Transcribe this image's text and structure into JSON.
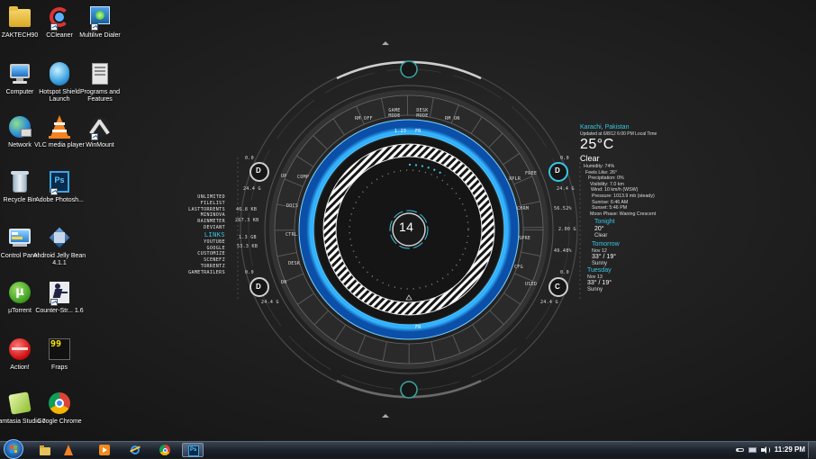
{
  "desktop_icons": [
    {
      "label": "ZAKTECH90",
      "icon": "folder-icon"
    },
    {
      "label": "CCleaner",
      "icon": "ccleaner-icon"
    },
    {
      "label": "Multilive Dialer",
      "icon": "dialer-icon"
    },
    {
      "label": "Computer",
      "icon": "computer-icon"
    },
    {
      "label": "Hotspot Shield Launch",
      "icon": "hotspot-shield-icon"
    },
    {
      "label": "Programs and Features",
      "icon": "programs-features-icon"
    },
    {
      "label": "Network",
      "icon": "network-icon"
    },
    {
      "label": "VLC media player",
      "icon": "vlc-icon"
    },
    {
      "label": "WinMount",
      "icon": "winmount-icon"
    },
    {
      "label": "Recycle Bin",
      "icon": "recycle-bin-icon"
    },
    {
      "label": "Adobe Photosh...",
      "icon": "photoshop-icon"
    },
    {
      "label": "Control Panel",
      "icon": "control-panel-icon"
    },
    {
      "label": "Android Jelly Bean 4.1.1",
      "icon": "virtualbox-icon"
    },
    {
      "label": "µTorrent",
      "icon": "utorrent-icon"
    },
    {
      "label": "Counter-Str... 1.6",
      "icon": "counter-strike-icon"
    },
    {
      "label": "Action!",
      "icon": "action-icon"
    },
    {
      "label": "Fraps",
      "icon": "fraps-icon"
    },
    {
      "label": "Camtasia Studio 7",
      "icon": "camtasia-icon"
    },
    {
      "label": "Google Chrome",
      "icon": "chrome-icon"
    }
  ],
  "hud": {
    "center_number": "14",
    "top_left_button": "RM OFF",
    "top_mid_button_1": "GAME MODE",
    "top_mid_button_2": "DESK MODE",
    "top_right_button": "RM ON",
    "inner_top_left": "1.23",
    "inner_top_right": "FR",
    "bottom_label": "FR",
    "left_segments": [
      "UP",
      "COMP",
      "DOCS",
      "CTRL",
      "DESK",
      "DN"
    ],
    "right_segments": [
      "FREE",
      "XPLR",
      "CHRM",
      "SPRE",
      "CFG",
      "USED"
    ],
    "drive_letters": [
      "D",
      "D",
      "D",
      "C"
    ],
    "left_stats": [
      {
        "top": "0.0",
        "bottom": "24.4 G"
      },
      {
        "top": "0.0",
        "bottom": "24.4 G"
      }
    ],
    "left_values": [
      "46.8 KB",
      "267.3 KB",
      "1.3 GB",
      "53.3 KB"
    ],
    "right_stats": [
      {
        "top": "0.0",
        "bottom": "24.4 G"
      },
      {
        "top": "0.0",
        "bottom": "24.4 G"
      }
    ],
    "right_values": [
      "56.52%",
      "2.00 G",
      "49.48%"
    ]
  },
  "links": {
    "top_items": [
      "UNLIMITED",
      "FILELIST",
      "LASTTORRENTS",
      "MININOVA",
      "RAINMETER",
      "DEVIANT"
    ],
    "header": "LINKS",
    "bottom_items": [
      "YOUTUBE",
      "GOOGLE",
      "CUSTOMIZE",
      "SCENEFZ",
      "TORRENTZ",
      "GAMETRAILERS"
    ]
  },
  "weather": {
    "city": "Karachi, Pakistan",
    "updated": "Updated at 6/8/12 6:00 PM Local Time",
    "temp": "25°C",
    "condition": "Clear",
    "details": [
      "Humidity: 74%",
      "Feels Like: 26°",
      "Precipitation: 0%",
      "Visibility: 7.0 km",
      "Wind: 10 km/h (WSW)",
      "Pressure: 1013.9 mb (steady)",
      "Sunrise: 6:46 AM",
      "Sunset: 5:46 PM",
      "Moon Phase: Waning Crescent"
    ],
    "tonight": {
      "title": "Tonight",
      "temp": "20°",
      "cond": "Clear"
    },
    "tomorrow": {
      "title": "Tomorrow",
      "date": "Nov 12",
      "temp": "33° / 19°",
      "cond": "Sunny"
    },
    "tuesday": {
      "title": "Tuesday",
      "date": "Nov 13",
      "temp": "33° / 19°",
      "cond": "Sunny"
    }
  },
  "taskbar": {
    "clock": "11:29 PM",
    "pinned": [
      "explorer-icon",
      "vlc-icon",
      "media-player-icon",
      "ie-icon",
      "chrome-icon",
      "photoshop-icon"
    ]
  },
  "colors": {
    "accent_cyan": "#37c6e6",
    "ring_blue": "#1e90ff",
    "bg": "#202020"
  }
}
